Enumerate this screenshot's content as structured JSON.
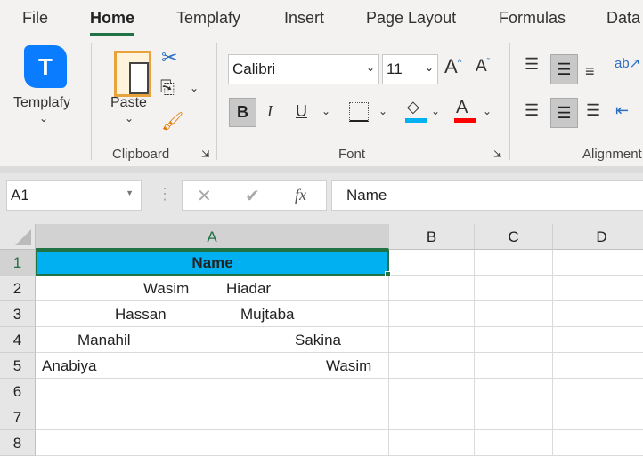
{
  "tabs": [
    "File",
    "Home",
    "Templafy",
    "Insert",
    "Page Layout",
    "Formulas",
    "Data"
  ],
  "ribbon": {
    "templafy": {
      "label": "Templafy",
      "logo_letter": "T",
      "color": "#0a7cff"
    },
    "clipboard": {
      "paste_label": "Paste",
      "group_label": "Clipboard"
    },
    "font": {
      "font_name": "Calibri",
      "font_size": "11",
      "bold": "B",
      "italic": "I",
      "underline": "U",
      "font_color_glyph": "A",
      "group_label": "Font",
      "fill_color": "#00b0f0",
      "font_color": "#ff0000"
    },
    "alignment": {
      "group_label": "Alignment"
    }
  },
  "formula_bar": {
    "name_box": "A1",
    "fx": "fx",
    "value": "Name"
  },
  "grid": {
    "columns": [
      "A",
      "B",
      "C",
      "D"
    ],
    "rows": [
      "1",
      "2",
      "3",
      "4",
      "5",
      "6",
      "7",
      "8"
    ],
    "header_cell": "Name",
    "header_fill": "#00b0f0",
    "cells": [
      [
        "Wasim",
        "Hiadar"
      ],
      [
        "Hassan",
        "Mujtaba"
      ],
      [
        "Manahil",
        "Sakina"
      ],
      [
        "Anabiya",
        "Wasim"
      ]
    ]
  }
}
